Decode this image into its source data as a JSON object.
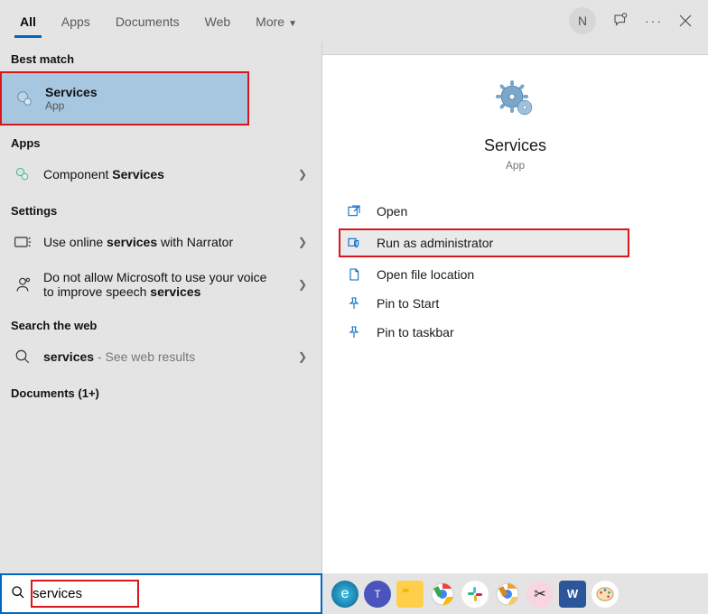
{
  "tabs": {
    "all": "All",
    "apps": "Apps",
    "documents": "Documents",
    "web": "Web",
    "more": "More"
  },
  "account_initial": "N",
  "left": {
    "best_match_head": "Best match",
    "best_match_title": "Services",
    "best_match_sub": "App",
    "apps_head": "Apps",
    "apps_item_prefix": "Component ",
    "apps_item_bold": "Services",
    "settings_head": "Settings",
    "setting1_a": "Use online ",
    "setting1_b": "services",
    "setting1_c": " with Narrator",
    "setting2_a": "Do not allow Microsoft to use your voice to improve speech ",
    "setting2_b": "services",
    "web_head": "Search the web",
    "web_item_bold": "services",
    "web_item_tail": " - See web results",
    "docs_head": "Documents (1+)"
  },
  "right": {
    "title": "Services",
    "sub": "App",
    "open": "Open",
    "run_admin": "Run as administrator",
    "open_loc": "Open file location",
    "pin_start": "Pin to Start",
    "pin_task": "Pin to taskbar"
  },
  "search_value": "services"
}
